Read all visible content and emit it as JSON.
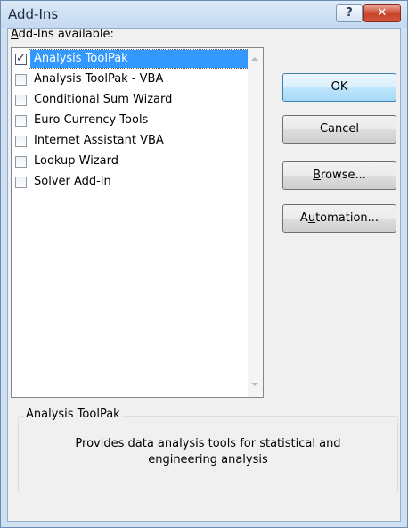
{
  "window": {
    "title": "Add-Ins",
    "help_button": "?",
    "close_button": "✕"
  },
  "list": {
    "label_prefix": "",
    "label_underlined": "A",
    "label_suffix": "dd-Ins available:",
    "items": [
      {
        "label": "Analysis ToolPak",
        "checked": true,
        "selected": true
      },
      {
        "label": "Analysis ToolPak - VBA",
        "checked": false,
        "selected": false
      },
      {
        "label": "Conditional Sum Wizard",
        "checked": false,
        "selected": false
      },
      {
        "label": "Euro Currency Tools",
        "checked": false,
        "selected": false
      },
      {
        "label": "Internet Assistant VBA",
        "checked": false,
        "selected": false
      },
      {
        "label": "Lookup Wizard",
        "checked": false,
        "selected": false
      },
      {
        "label": "Solver Add-in",
        "checked": false,
        "selected": false
      }
    ]
  },
  "buttons": {
    "ok": "OK",
    "cancel": "Cancel",
    "browse_underlined": "B",
    "browse_rest": "rowse...",
    "automation_pre": "A",
    "automation_underlined": "u",
    "automation_rest": "tomation..."
  },
  "details": {
    "group_title": "Analysis ToolPak",
    "description_line1": "Provides data analysis tools for statistical and",
    "description_line2": "engineering analysis"
  },
  "colors": {
    "selection": "#3399ff",
    "title_bar": "#c4d9ef",
    "close_button": "#c8442b"
  }
}
